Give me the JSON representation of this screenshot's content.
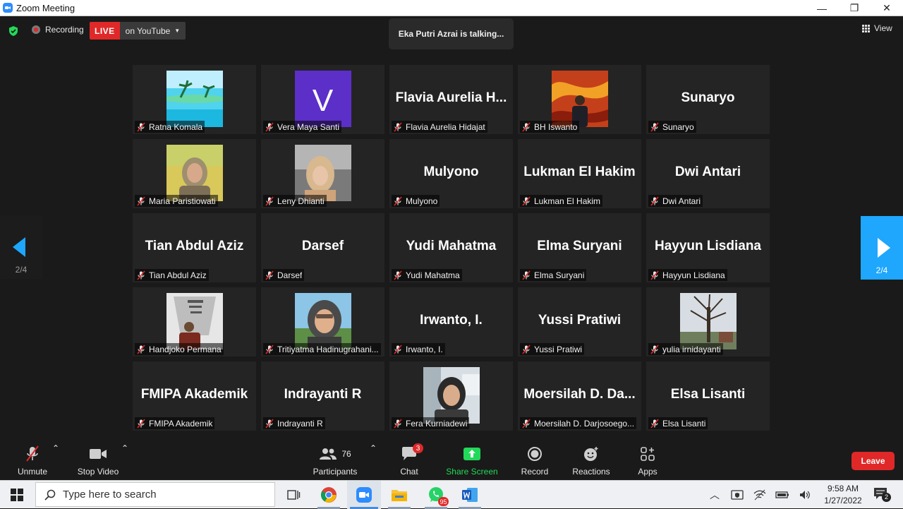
{
  "window": {
    "title": "Zoom Meeting",
    "minimize": "—",
    "maximize": "❐",
    "close": "✕"
  },
  "top_bar": {
    "recording_label": "Recording",
    "live_label": "LIVE",
    "live_target": "on YouTube",
    "talking_text": "Eka Putri Azrai is talking...",
    "view_label": "View"
  },
  "pagination": {
    "left_page": "2/4",
    "right_page": "2/4"
  },
  "participants_grid": [
    [
      {
        "big": "",
        "label": "Ratna Komala",
        "photo": "beach"
      },
      {
        "big": "",
        "label": "Vera Maya Santi",
        "photo": "letter",
        "letter": "V"
      },
      {
        "big": "Flavia Aurelia H...",
        "label": "Flavia Aurelia Hidajat",
        "photo": "none"
      },
      {
        "big": "",
        "label": "BH Iswanto",
        "photo": "painting"
      },
      {
        "big": "Sunaryo",
        "label": "Sunaryo",
        "photo": "none"
      }
    ],
    [
      {
        "big": "",
        "label": "Maria Paristiowati",
        "photo": "person-yellow"
      },
      {
        "big": "",
        "label": "Leny Dhianti",
        "photo": "person-car"
      },
      {
        "big": "Mulyono",
        "label": "Mulyono",
        "photo": "none"
      },
      {
        "big": "Lukman El Hakim",
        "label": "Lukman El Hakim",
        "photo": "none"
      },
      {
        "big": "Dwi Antari",
        "label": "Dwi Antari",
        "photo": "none"
      }
    ],
    [
      {
        "big": "Tian Abdul Aziz",
        "label": "Tian Abdul Aziz",
        "photo": "none"
      },
      {
        "big": "Darsef",
        "label": "Darsef",
        "photo": "none"
      },
      {
        "big": "Yudi Mahatma",
        "label": "Yudi Mahatma",
        "photo": "none"
      },
      {
        "big": "Elma Suryani",
        "label": "Elma Suryani",
        "photo": "none"
      },
      {
        "big": "Hayyun Lisdiana",
        "label": "Hayyun Lisdiana",
        "photo": "none"
      }
    ],
    [
      {
        "big": "",
        "label": "Handjoko Permana",
        "photo": "person-wall"
      },
      {
        "big": "",
        "label": "Tritiyatma Hadinugrahani...",
        "photo": "person-sky"
      },
      {
        "big": "Irwanto, I.",
        "label": "Irwanto, I.",
        "photo": "none"
      },
      {
        "big": "Yussi Pratiwi",
        "label": "Yussi Pratiwi",
        "photo": "none"
      },
      {
        "big": "",
        "label": "yulia irnidayanti",
        "photo": "tree"
      }
    ],
    [
      {
        "big": "FMIPA Akademik",
        "label": "FMIPA Akademik",
        "photo": "none"
      },
      {
        "big": "Indrayanti R",
        "label": "Indrayanti R",
        "photo": "none"
      },
      {
        "big": "",
        "label": "Fera Kurniadewi",
        "photo": "person-room"
      },
      {
        "big": "Moersilah D. Da...",
        "label": "Moersilah D. Darjosoego...",
        "photo": "none"
      },
      {
        "big": "Elsa Lisanti",
        "label": "Elsa Lisanti",
        "photo": "none"
      }
    ]
  ],
  "toolbar": {
    "unmute": "Unmute",
    "stop_video": "Stop Video",
    "participants": "Participants",
    "participants_count": "76",
    "chat": "Chat",
    "chat_badge": "3",
    "share_screen": "Share Screen",
    "record": "Record",
    "reactions": "Reactions",
    "apps": "Apps",
    "leave": "Leave"
  },
  "taskbar": {
    "search_placeholder": "Type here to search",
    "whatsapp_badge": "95",
    "time": "9:58 AM",
    "date": "1/27/2022",
    "notifications": "2"
  },
  "colors": {
    "accent_blue": "#1ea7fd",
    "live_red": "#e02828",
    "share_green": "#23d959",
    "tile_bg": "#242424"
  }
}
